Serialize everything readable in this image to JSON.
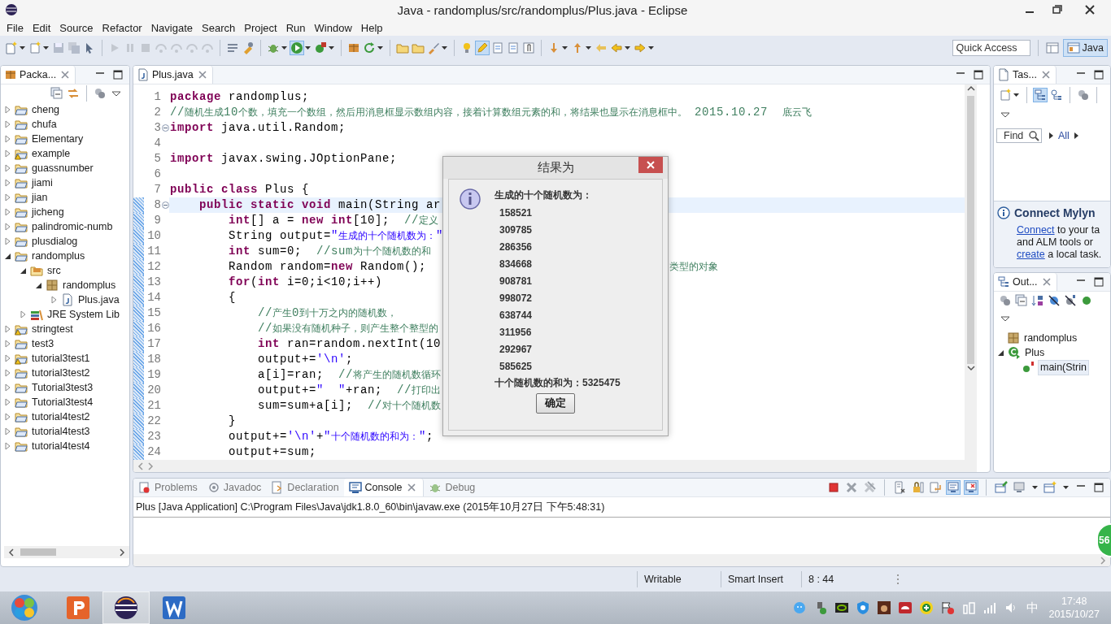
{
  "window": {
    "title": "Java - randomplus/src/randomplus/Plus.java - Eclipse"
  },
  "menu": [
    "File",
    "Edit",
    "Source",
    "Refactor",
    "Navigate",
    "Search",
    "Project",
    "Run",
    "Window",
    "Help"
  ],
  "toolbar": {
    "quick_access": {
      "placeholder": "Quick Access"
    },
    "perspectives": [
      {
        "label": "Java",
        "selected": true
      }
    ]
  },
  "package_explorer": {
    "tab": "Packa...",
    "tree": [
      {
        "label": "cheng",
        "kind": "project",
        "expanded": false
      },
      {
        "label": "chufa",
        "kind": "project",
        "expanded": false
      },
      {
        "label": "Elementary",
        "kind": "project",
        "expanded": false
      },
      {
        "label": "example",
        "kind": "project",
        "expanded": false,
        "warning": true
      },
      {
        "label": "guassnumber",
        "kind": "project",
        "expanded": false
      },
      {
        "label": "jiami",
        "kind": "project",
        "expanded": false
      },
      {
        "label": "jian",
        "kind": "project",
        "expanded": false
      },
      {
        "label": "jicheng",
        "kind": "project",
        "expanded": false
      },
      {
        "label": "palindromic-numb",
        "kind": "project",
        "expanded": false
      },
      {
        "label": "plusdialog",
        "kind": "project",
        "expanded": false
      },
      {
        "label": "randomplus",
        "kind": "project",
        "expanded": true,
        "children": [
          {
            "label": "src",
            "kind": "source",
            "expanded": true,
            "children": [
              {
                "label": "randomplus",
                "kind": "package",
                "expanded": true,
                "children": [
                  {
                    "label": "Plus.java",
                    "kind": "file",
                    "expanded": false
                  }
                ]
              }
            ]
          },
          {
            "label": "JRE System Lib",
            "kind": "library",
            "expanded": false
          }
        ]
      },
      {
        "label": "stringtest",
        "kind": "project",
        "expanded": false,
        "warning": true
      },
      {
        "label": "test3",
        "kind": "project",
        "expanded": false
      },
      {
        "label": "tutorial3test1",
        "kind": "project",
        "expanded": false,
        "warning": true
      },
      {
        "label": "tutorial3test2",
        "kind": "project",
        "expanded": false
      },
      {
        "label": "Tutorial3test3",
        "kind": "project",
        "expanded": false
      },
      {
        "label": "Tutorial3test4",
        "kind": "project",
        "expanded": false
      },
      {
        "label": "tutorial4test2",
        "kind": "project",
        "expanded": false
      },
      {
        "label": "tutorial4test3",
        "kind": "project",
        "expanded": false
      },
      {
        "label": "tutorial4test4",
        "kind": "project",
        "expanded": false
      }
    ]
  },
  "editor": {
    "tabs": [
      {
        "label": "Plus.java",
        "selected": true
      }
    ],
    "lines": [
      {
        "n": "1",
        "current": false,
        "tokens": [
          {
            "kind": "kw",
            "text": "package"
          },
          {
            "kind": "plain",
            "text": " randomplus;"
          }
        ]
      },
      {
        "n": "2",
        "current": false,
        "tokens": [
          {
            "kind": "comment",
            "text": "//随机生成10个数，填充一个数组，然后用消息框显示数组内容，接着计算数组元素的和，将结果也显示在消息框中。 2015.10.27  底云飞"
          }
        ]
      },
      {
        "n": "3",
        "current": false,
        "fold": true,
        "tokens": [
          {
            "kind": "kw",
            "text": "import"
          },
          {
            "kind": "plain",
            "text": " java.util.Random;"
          }
        ]
      },
      {
        "n": "4",
        "current": false
      },
      {
        "n": "5",
        "current": false,
        "tokens": [
          {
            "kind": "kw",
            "text": "import"
          },
          {
            "kind": "plain",
            "text": " javax.swing.JOptionPane;"
          }
        ]
      },
      {
        "n": "6",
        "current": false
      },
      {
        "n": "7",
        "current": false,
        "tokens": [
          {
            "kind": "kw",
            "text": "public class"
          },
          {
            "kind": "plain",
            "text": " Plus {"
          }
        ]
      },
      {
        "n": "8",
        "current": true,
        "fold": true,
        "changed": true,
        "tokens": [
          {
            "kind": "kw",
            "text": "\tpublic static void"
          },
          {
            "kind": "plain",
            "text": " main(String ar"
          }
        ]
      },
      {
        "n": "9",
        "current": false,
        "changed": true,
        "tokens": [
          {
            "kind": "kw",
            "text": "\t\tint"
          },
          {
            "kind": "plain",
            "text": "[] a = "
          },
          {
            "kind": "kw",
            "text": "new int"
          },
          {
            "kind": "plain",
            "text": "[10];  "
          },
          {
            "kind": "comment",
            "text": "//定义"
          }
        ]
      },
      {
        "n": "10",
        "current": false,
        "changed": true,
        "tokens": [
          {
            "kind": "plain",
            "text": "\t\tString output="
          },
          {
            "kind": "string",
            "text": "\"生成的十个随机数为：\""
          }
        ]
      },
      {
        "n": "11",
        "current": false,
        "changed": true,
        "tokens": [
          {
            "kind": "kw",
            "text": "\t\tint"
          },
          {
            "kind": "plain",
            "text": " sum=0;  "
          },
          {
            "kind": "comment",
            "text": "//sum为十个随机数的和"
          }
        ]
      },
      {
        "n": "12",
        "current": false,
        "changed": true,
        "tokens": [
          {
            "kind": "plain",
            "text": "\t\tRandom random="
          },
          {
            "kind": "kw",
            "text": "new"
          },
          {
            "kind": "plain",
            "text": " Random();"
          }
        ],
        "tail": "类型的对象"
      },
      {
        "n": "13",
        "current": false,
        "changed": true,
        "tokens": [
          {
            "kind": "kw",
            "text": "\t\tfor"
          },
          {
            "kind": "plain",
            "text": "("
          },
          {
            "kind": "kw",
            "text": "int"
          },
          {
            "kind": "plain",
            "text": " i=0;i<10;i++)"
          }
        ]
      },
      {
        "n": "14",
        "current": false,
        "changed": true,
        "tokens": [
          {
            "kind": "plain",
            "text": "\t\t{"
          }
        ]
      },
      {
        "n": "15",
        "current": false,
        "changed": true,
        "tokens": [
          {
            "kind": "comment",
            "text": "\t\t\t//产生0到十万之内的随机数，"
          }
        ]
      },
      {
        "n": "16",
        "current": false,
        "changed": true,
        "tokens": [
          {
            "kind": "comment",
            "text": "\t\t\t//如果没有随机种子，则产生整个整型的"
          }
        ]
      },
      {
        "n": "17",
        "current": false,
        "changed": true,
        "tokens": [
          {
            "kind": "kw",
            "text": "\t\t\tint"
          },
          {
            "kind": "plain",
            "text": " ran=random.nextInt(10"
          }
        ]
      },
      {
        "n": "18",
        "current": false,
        "changed": true,
        "tokens": [
          {
            "kind": "plain",
            "text": "\t\t\toutput+="
          },
          {
            "kind": "string",
            "text": "'\\n'"
          },
          {
            "kind": "plain",
            "text": ";"
          }
        ]
      },
      {
        "n": "19",
        "current": false,
        "changed": true,
        "tokens": [
          {
            "kind": "plain",
            "text": "\t\t\ta[i]=ran;  "
          },
          {
            "kind": "comment",
            "text": "//将产生的随机数循环"
          }
        ]
      },
      {
        "n": "20",
        "current": false,
        "changed": true,
        "tokens": [
          {
            "kind": "plain",
            "text": "\t\t\toutput+="
          },
          {
            "kind": "string",
            "text": "\"  \""
          },
          {
            "kind": "plain",
            "text": "+ran;  "
          },
          {
            "kind": "comment",
            "text": "//打印出"
          }
        ]
      },
      {
        "n": "21",
        "current": false,
        "changed": true,
        "tokens": [
          {
            "kind": "plain",
            "text": "\t\t\tsum=sum+a[i];  "
          },
          {
            "kind": "comment",
            "text": "//对十个随机数"
          }
        ]
      },
      {
        "n": "22",
        "current": false,
        "changed": true,
        "tokens": [
          {
            "kind": "plain",
            "text": "\t\t}"
          }
        ]
      },
      {
        "n": "23",
        "current": false,
        "changed": true,
        "tokens": [
          {
            "kind": "plain",
            "text": "\t\toutput+="
          },
          {
            "kind": "string",
            "text": "'\\n'"
          },
          {
            "kind": "plain",
            "text": "+"
          },
          {
            "kind": "string",
            "text": "\"十个随机数的和为：\""
          },
          {
            "kind": "plain",
            "text": ";"
          }
        ]
      },
      {
        "n": "24",
        "current": false,
        "changed": true,
        "tokens": [
          {
            "kind": "plain",
            "text": "\t\toutput+=sum;"
          }
        ]
      }
    ]
  },
  "task_list": {
    "tab": "Tas...",
    "find": {
      "placeholder": "Find"
    },
    "filters": [
      "All"
    ],
    "mylyn": {
      "title": "Connect Mylyn",
      "lines": [
        [
          {
            "kind": "link",
            "text": "Connect"
          },
          {
            "kind": "text",
            "text": " to your ta"
          }
        ],
        [
          {
            "kind": "text",
            "text": "and ALM tools or"
          }
        ],
        [
          {
            "kind": "link",
            "text": "create"
          },
          {
            "kind": "text",
            "text": " a local task."
          }
        ]
      ]
    }
  },
  "outline": {
    "tab": "Out...",
    "tree": [
      {
        "label": "randomplus",
        "kind": "package",
        "selected": false
      },
      {
        "label": "Plus",
        "kind": "class",
        "selected": false,
        "expanded": true,
        "children": [
          {
            "label": "main(Strin",
            "kind": "method",
            "selected": true
          }
        ]
      }
    ]
  },
  "console": {
    "tabs": [
      {
        "label": "Problems",
        "kind": "problems",
        "selected": false
      },
      {
        "label": "Javadoc",
        "kind": "javadoc",
        "selected": false
      },
      {
        "label": "Declaration",
        "kind": "declaration",
        "selected": false
      },
      {
        "label": "Console",
        "kind": "console",
        "selected": true
      },
      {
        "label": "Debug",
        "kind": "debug",
        "selected": false
      }
    ],
    "header": "Plus [Java Application] C:\\Program Files\\Java\\jdk1.8.0_60\\bin\\javaw.exe (2015年10月27日 下午5:48:31)"
  },
  "status_bar": [
    "Writable",
    "Smart Insert",
    "8 : 44"
  ],
  "dialog": {
    "title": "结果为",
    "heading": "生成的十个随机数为：",
    "numbers": [
      "158521",
      "309785",
      "286356",
      "834668",
      "908781",
      "998072",
      "638744",
      "311956",
      "292967",
      "585625"
    ],
    "sum": "十个随机数的和为：5325475",
    "button": "确定"
  },
  "speed_ball": "56",
  "taskbar": {
    "apps": [
      {
        "kind": "presentation",
        "selected": false
      },
      {
        "kind": "ide",
        "selected": true
      },
      {
        "kind": "writer",
        "selected": false
      }
    ],
    "ime": "中",
    "time": "17:48",
    "date": "2015/10/27"
  }
}
